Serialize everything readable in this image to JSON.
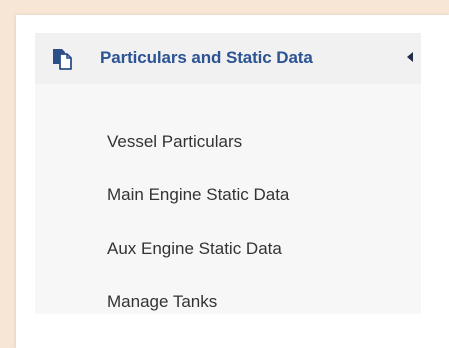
{
  "sidebar": {
    "section": {
      "label": "Particulars and Static Data",
      "icon": "document-copy-icon",
      "expanded": true,
      "items": [
        {
          "label": "Vessel Particulars"
        },
        {
          "label": "Main Engine Static Data"
        },
        {
          "label": "Aux Engine Static Data"
        },
        {
          "label": "Manage Tanks"
        }
      ]
    }
  },
  "colors": {
    "page_background": "#f7e6d6",
    "header_text": "#2c5494",
    "header_background": "#f1f1f1",
    "submenu_background": "#f7f7f7",
    "item_text": "#333333"
  }
}
